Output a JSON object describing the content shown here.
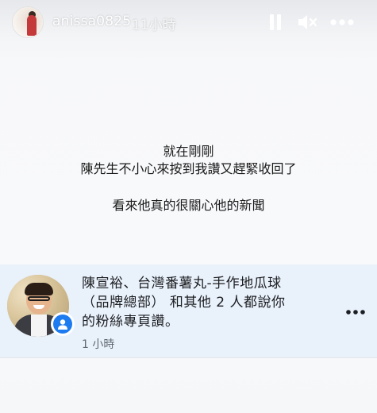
{
  "story_header": {
    "username": "anissa0825",
    "time_ago": "11小時",
    "icons": {
      "pause": "pause-icon",
      "mute": "muted-speaker-icon",
      "more": "more-horizontal-icon"
    }
  },
  "story_text": {
    "line1": "就在剛剛",
    "line2": "陳先生不小心來按到我讚又趕緊收回了",
    "line3": "看來他真的很關心他的新聞"
  },
  "notification": {
    "line1": "陳宣裕、台灣番薯丸-手作地瓜球",
    "line2": "（品牌總部） 和其他 2 人都說你",
    "line3": "的粉絲專頁讚。",
    "time": "1 小時",
    "icons": {
      "badge": "page-profile-icon",
      "more": "more-horizontal-icon"
    }
  },
  "colors": {
    "notification_bg": "#e9f1fb",
    "badge_blue": "#1d7bf0",
    "text_dark": "#1c1e21",
    "time_gray": "#606770"
  }
}
